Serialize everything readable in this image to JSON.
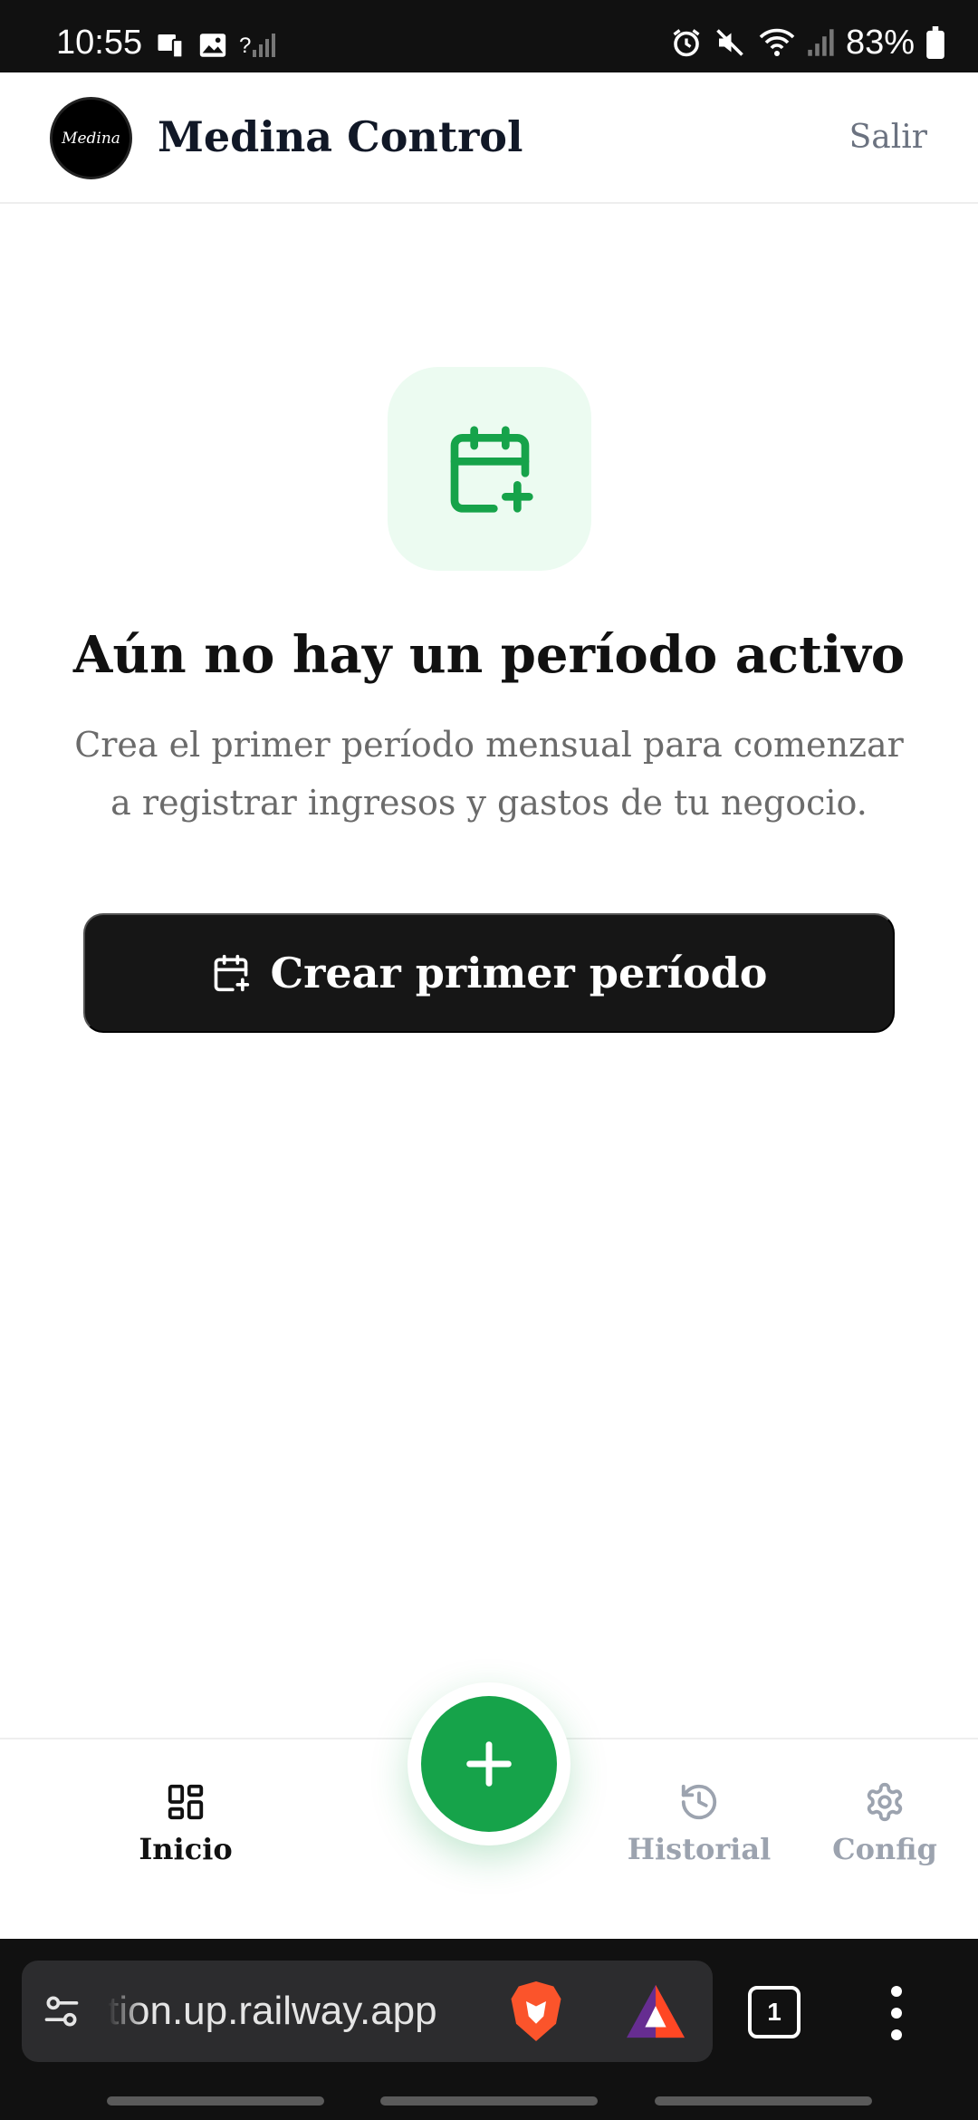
{
  "status_bar": {
    "time": "10:55",
    "battery": "83%",
    "cellular_badge": "?"
  },
  "header": {
    "logo_text": "Medina",
    "title": "Medina Control",
    "logout_label": "Salir"
  },
  "empty_state": {
    "icon": "calendar-plus-icon",
    "title": "Aún no hay un período activo",
    "subtitle": "Crea el primer período mensual para comenzar a registrar ingresos y gastos de tu negocio.",
    "button_label": "Crear primer período"
  },
  "bottom_nav": {
    "items": [
      {
        "label": "Inicio",
        "icon": "dashboard-grid-icon",
        "active": true
      },
      {
        "label": "Historial",
        "icon": "history-icon",
        "active": false
      },
      {
        "label": "Config",
        "icon": "gear-icon",
        "active": false
      }
    ],
    "fab_icon": "plus-icon"
  },
  "browser": {
    "url": "tion.up.railway.app",
    "tab_count": "1"
  },
  "colors": {
    "accent_green": "#16a34a",
    "icon_bg": "#ecfbf1",
    "button_dark": "#161616",
    "muted_text": "#6b7280"
  }
}
